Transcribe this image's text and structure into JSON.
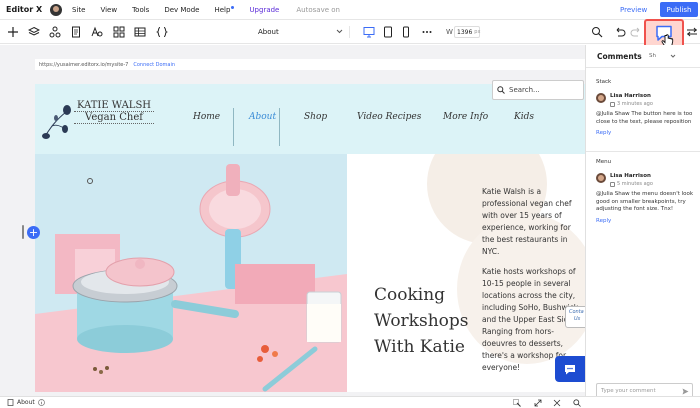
{
  "app": {
    "logo": "Editor X",
    "menu": [
      "Site",
      "View",
      "Tools",
      "Dev Mode",
      "Help",
      "Upgrade"
    ],
    "autosave": "Autosave on",
    "preview_label": "Preview",
    "publish_label": "Publish"
  },
  "toolbar": {
    "page_select": "About",
    "width_label": "W",
    "width_value": "1396",
    "width_unit": "px"
  },
  "canvas": {
    "url": "https://yusaimer.editorx.io/mysite-7",
    "connect_domain": "Connect Domain"
  },
  "site": {
    "brand_name": "KATIE WALSH",
    "brand_tagline": "Vegan Chef",
    "nav": [
      "Home",
      "About",
      "Shop",
      "Video Recipes",
      "More Info",
      "Kids"
    ],
    "search_placeholder": "Search...",
    "hero_paragraph_1": "Katie Walsh is a professional vegan chef with over 15 years of experience, working for the best restaurants in NYC.",
    "hero_paragraph_2": "Katie hosts workshops of 10-15 people in several locations across the city, including SoHo, Bushwick and the Upper East Side. Ranging from hors-doeuvres to desserts, there's a workshop for everyone!",
    "hero_title_lines": [
      "Cooking",
      "Workshops",
      "With Katie"
    ],
    "contact_tab_lines": [
      "Conta",
      "Us"
    ]
  },
  "comments_panel": {
    "title": "Comments",
    "filter_label": "Sh",
    "threads": [
      {
        "section": "Stack",
        "author": "Lisa Harrison",
        "time": "3 minutes ago",
        "text": "@Julia Shaw The button here is too close to the text, please reposition",
        "reply_label": "Reply"
      },
      {
        "section": "Menu",
        "author": "Lisa Harrison",
        "time": "5 minutes ago",
        "text": "@Julia Shaw the menu doesn't look good on smaller breakpoints, try adjusting the font size. Tnx!",
        "reply_label": "Reply"
      }
    ],
    "input_placeholder": "Type your comment"
  },
  "bottombar": {
    "page": "About"
  },
  "colors": {
    "accent": "#3b6cf6",
    "highlight_border": "#f0524d",
    "header_bg": "#dcf3f7"
  },
  "icons": [
    "plus-icon",
    "layers-icon",
    "components-icon",
    "pages-icon",
    "text-style-icon",
    "grid-icon",
    "table-icon",
    "code-icon",
    "desktop-icon",
    "tablet-icon",
    "mobile-icon",
    "more-icon",
    "zoom-icon",
    "undo-icon",
    "redo-icon",
    "comment-icon",
    "cursor-hand-icon",
    "sliders-icon",
    "search-icon",
    "chat-icon",
    "send-icon",
    "info-icon"
  ]
}
